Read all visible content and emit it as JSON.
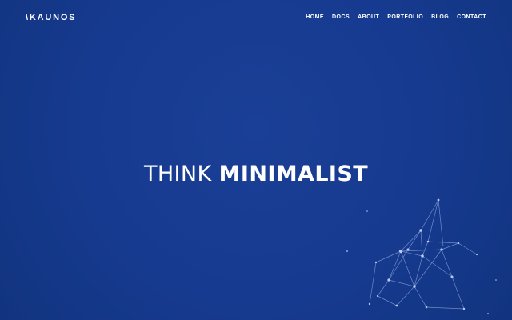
{
  "brand": {
    "logo_text": "\\KAUNOS"
  },
  "nav": {
    "items": [
      {
        "label": "HOME"
      },
      {
        "label": "DOCS"
      },
      {
        "label": "ABOUT"
      },
      {
        "label": "PORTFOLIO"
      },
      {
        "label": "BLOG"
      },
      {
        "label": "CONTACT"
      }
    ]
  },
  "hero": {
    "light_text": "THINK ",
    "bold_text": "MINIMALIST"
  },
  "colors": {
    "background": "#163a8f",
    "text": "#ffffff",
    "network": "#9fb4e6"
  },
  "decor": {
    "icon": "network-graph-icon"
  }
}
